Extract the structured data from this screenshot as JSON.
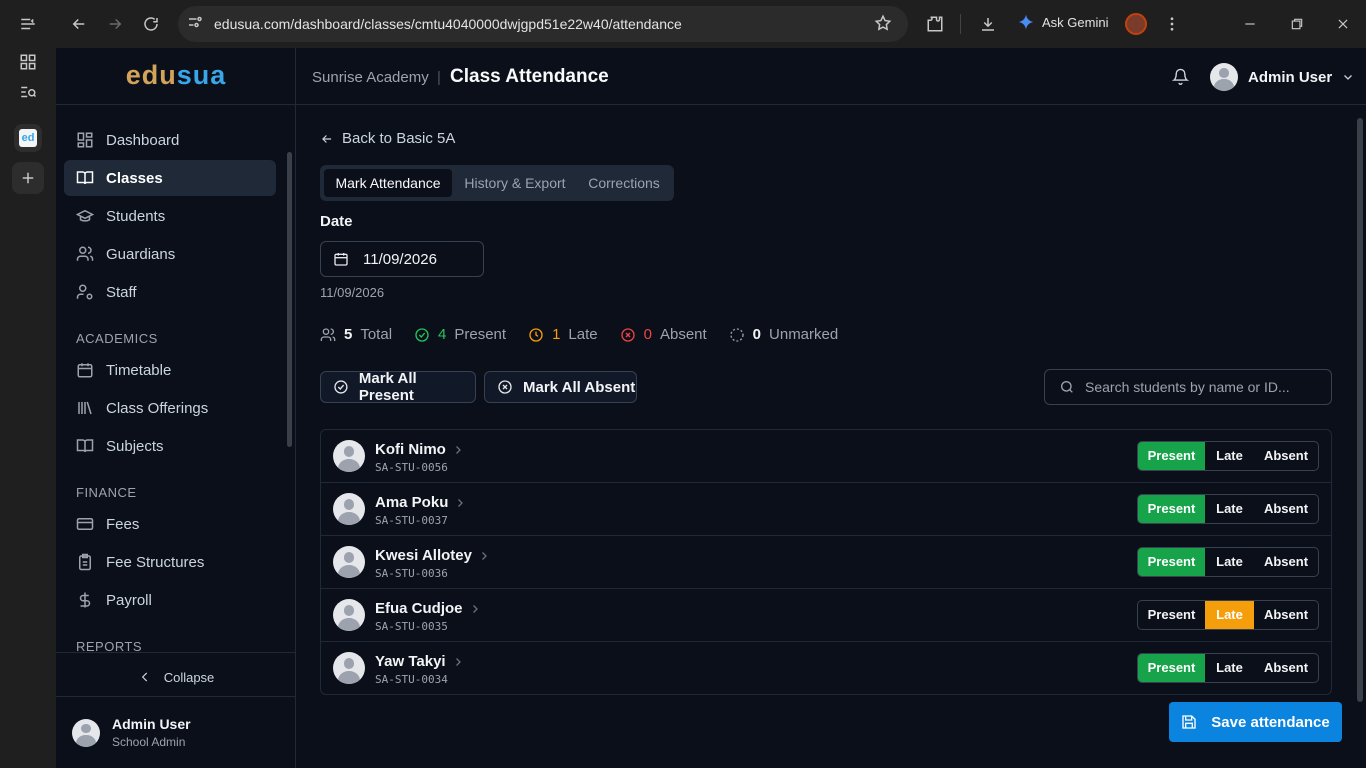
{
  "browser": {
    "url": "edusua.com/dashboard/classes/cmtu4040000dwjgpd51e22w40/attendance",
    "ask_gemini": "Ask Gemini",
    "rail_app": "ed"
  },
  "app": {
    "logo_part1": "edu",
    "logo_part2": "sua",
    "brand_gold": "#d4a35a",
    "brand_blue": "#38a6e8"
  },
  "sidebar": {
    "items": [
      {
        "label": "Dashboard",
        "icon": "grid-icon"
      },
      {
        "label": "Classes",
        "icon": "book-open-icon",
        "active": true
      },
      {
        "label": "Students",
        "icon": "graduation-cap-icon"
      },
      {
        "label": "Guardians",
        "icon": "users-icon"
      },
      {
        "label": "Staff",
        "icon": "user-cog-icon"
      }
    ],
    "sections": [
      {
        "title": "ACADEMICS",
        "items": [
          {
            "label": "Timetable",
            "icon": "calendar-icon"
          },
          {
            "label": "Class Offerings",
            "icon": "library-icon"
          },
          {
            "label": "Subjects",
            "icon": "book-icon"
          }
        ]
      },
      {
        "title": "FINANCE",
        "items": [
          {
            "label": "Fees",
            "icon": "credit-card-icon"
          },
          {
            "label": "Fee Structures",
            "icon": "clipboard-icon"
          },
          {
            "label": "Payroll",
            "icon": "dollar-icon"
          }
        ]
      },
      {
        "title": "REPORTS",
        "items": []
      }
    ],
    "collapse_label": "Collapse",
    "user_name": "Admin User",
    "user_role": "School Admin"
  },
  "header": {
    "school": "Sunrise Academy",
    "separator": "|",
    "title": "Class Attendance",
    "user_name": "Admin User"
  },
  "main": {
    "back_label": "Back to Basic 5A",
    "tabs": [
      {
        "label": "Mark Attendance",
        "active": true
      },
      {
        "label": "History & Export"
      },
      {
        "label": "Corrections"
      }
    ],
    "date_label": "Date",
    "date_value": "11/09/2026",
    "date_sub": "11/09/2026",
    "stats": {
      "total": {
        "count": "5",
        "label": "Total"
      },
      "present": {
        "count": "4",
        "label": "Present",
        "color": "#22c55e"
      },
      "late": {
        "count": "1",
        "label": "Late",
        "color": "#f59e0b"
      },
      "absent": {
        "count": "0",
        "label": "Absent",
        "color": "#ef4444"
      },
      "unmarked": {
        "count": "0",
        "label": "Unmarked"
      }
    },
    "mark_all_present": "Mark All Present",
    "mark_all_absent": "Mark All Absent",
    "search_placeholder": "Search students by name or ID...",
    "status_labels": {
      "present": "Present",
      "late": "Late",
      "absent": "Absent"
    },
    "students": [
      {
        "name": "Kofi Nimo",
        "id": "SA-STU-0056",
        "status": "present"
      },
      {
        "name": "Ama Poku",
        "id": "SA-STU-0037",
        "status": "present"
      },
      {
        "name": "Kwesi Allotey",
        "id": "SA-STU-0036",
        "status": "present"
      },
      {
        "name": "Efua Cudjoe",
        "id": "SA-STU-0035",
        "status": "late"
      },
      {
        "name": "Yaw Takyi",
        "id": "SA-STU-0034",
        "status": "present"
      }
    ],
    "save_label": "Save attendance"
  }
}
